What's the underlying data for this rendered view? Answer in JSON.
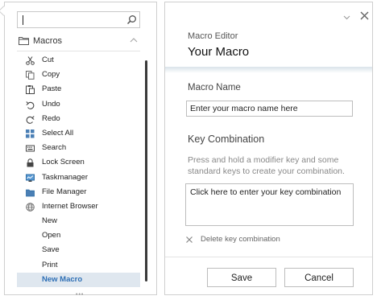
{
  "search": {
    "placeholder": ""
  },
  "macros_section": {
    "label": "Macros"
  },
  "menu_items": [
    {
      "label": "Cut",
      "icon": "scissors-icon"
    },
    {
      "label": "Copy",
      "icon": "copy-icon"
    },
    {
      "label": "Paste",
      "icon": "paste-icon"
    },
    {
      "label": "Undo",
      "icon": "undo-icon"
    },
    {
      "label": "Redo",
      "icon": "redo-icon"
    },
    {
      "label": "Select All",
      "icon": "select-all-icon"
    },
    {
      "label": "Search",
      "icon": "keyboard-icon"
    },
    {
      "label": "Lock Screen",
      "icon": "lock-icon"
    },
    {
      "label": "Taskmanager",
      "icon": "monitor-icon"
    },
    {
      "label": "File Manager",
      "icon": "folder-icon"
    },
    {
      "label": "Internet Browser",
      "icon": "globe-icon"
    },
    {
      "label": "New",
      "icon": ""
    },
    {
      "label": "Open",
      "icon": ""
    },
    {
      "label": "Save",
      "icon": ""
    },
    {
      "label": "Print",
      "icon": ""
    },
    {
      "label": "New Macro",
      "icon": "",
      "selected": true
    }
  ],
  "editor": {
    "subtitle": "Macro Editor",
    "title": "Your Macro",
    "name_label": "Macro Name",
    "name_placeholder": "Enter your macro name here",
    "key_label": "Key Combination",
    "key_help": "Press and hold a modifier key and some standard keys to create your combination.",
    "key_field_text": "Click here to enter your key combination",
    "delete_label": "Delete key combination",
    "save_label": "Save",
    "cancel_label": "Cancel"
  },
  "colors": {
    "accent": "#2e6fb5",
    "selected_bg": "#dfe7ef",
    "border": "#bdbdbd"
  }
}
